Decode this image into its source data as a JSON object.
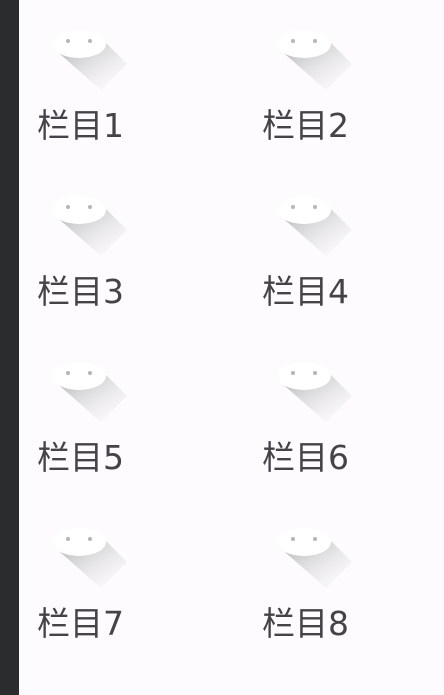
{
  "grid": {
    "items": [
      {
        "label": "栏目1",
        "icon": "app-icon"
      },
      {
        "label": "栏目2",
        "icon": "app-icon"
      },
      {
        "label": "栏目3",
        "icon": "app-icon"
      },
      {
        "label": "栏目4",
        "icon": "app-icon"
      },
      {
        "label": "栏目5",
        "icon": "app-icon"
      },
      {
        "label": "栏目6",
        "icon": "app-icon"
      },
      {
        "label": "栏目7",
        "icon": "app-icon"
      },
      {
        "label": "栏目8",
        "icon": "app-icon"
      }
    ]
  },
  "colors": {
    "background": "#fdfbfe",
    "side_strip": "#2b2c2e",
    "label_text": "#454347"
  }
}
